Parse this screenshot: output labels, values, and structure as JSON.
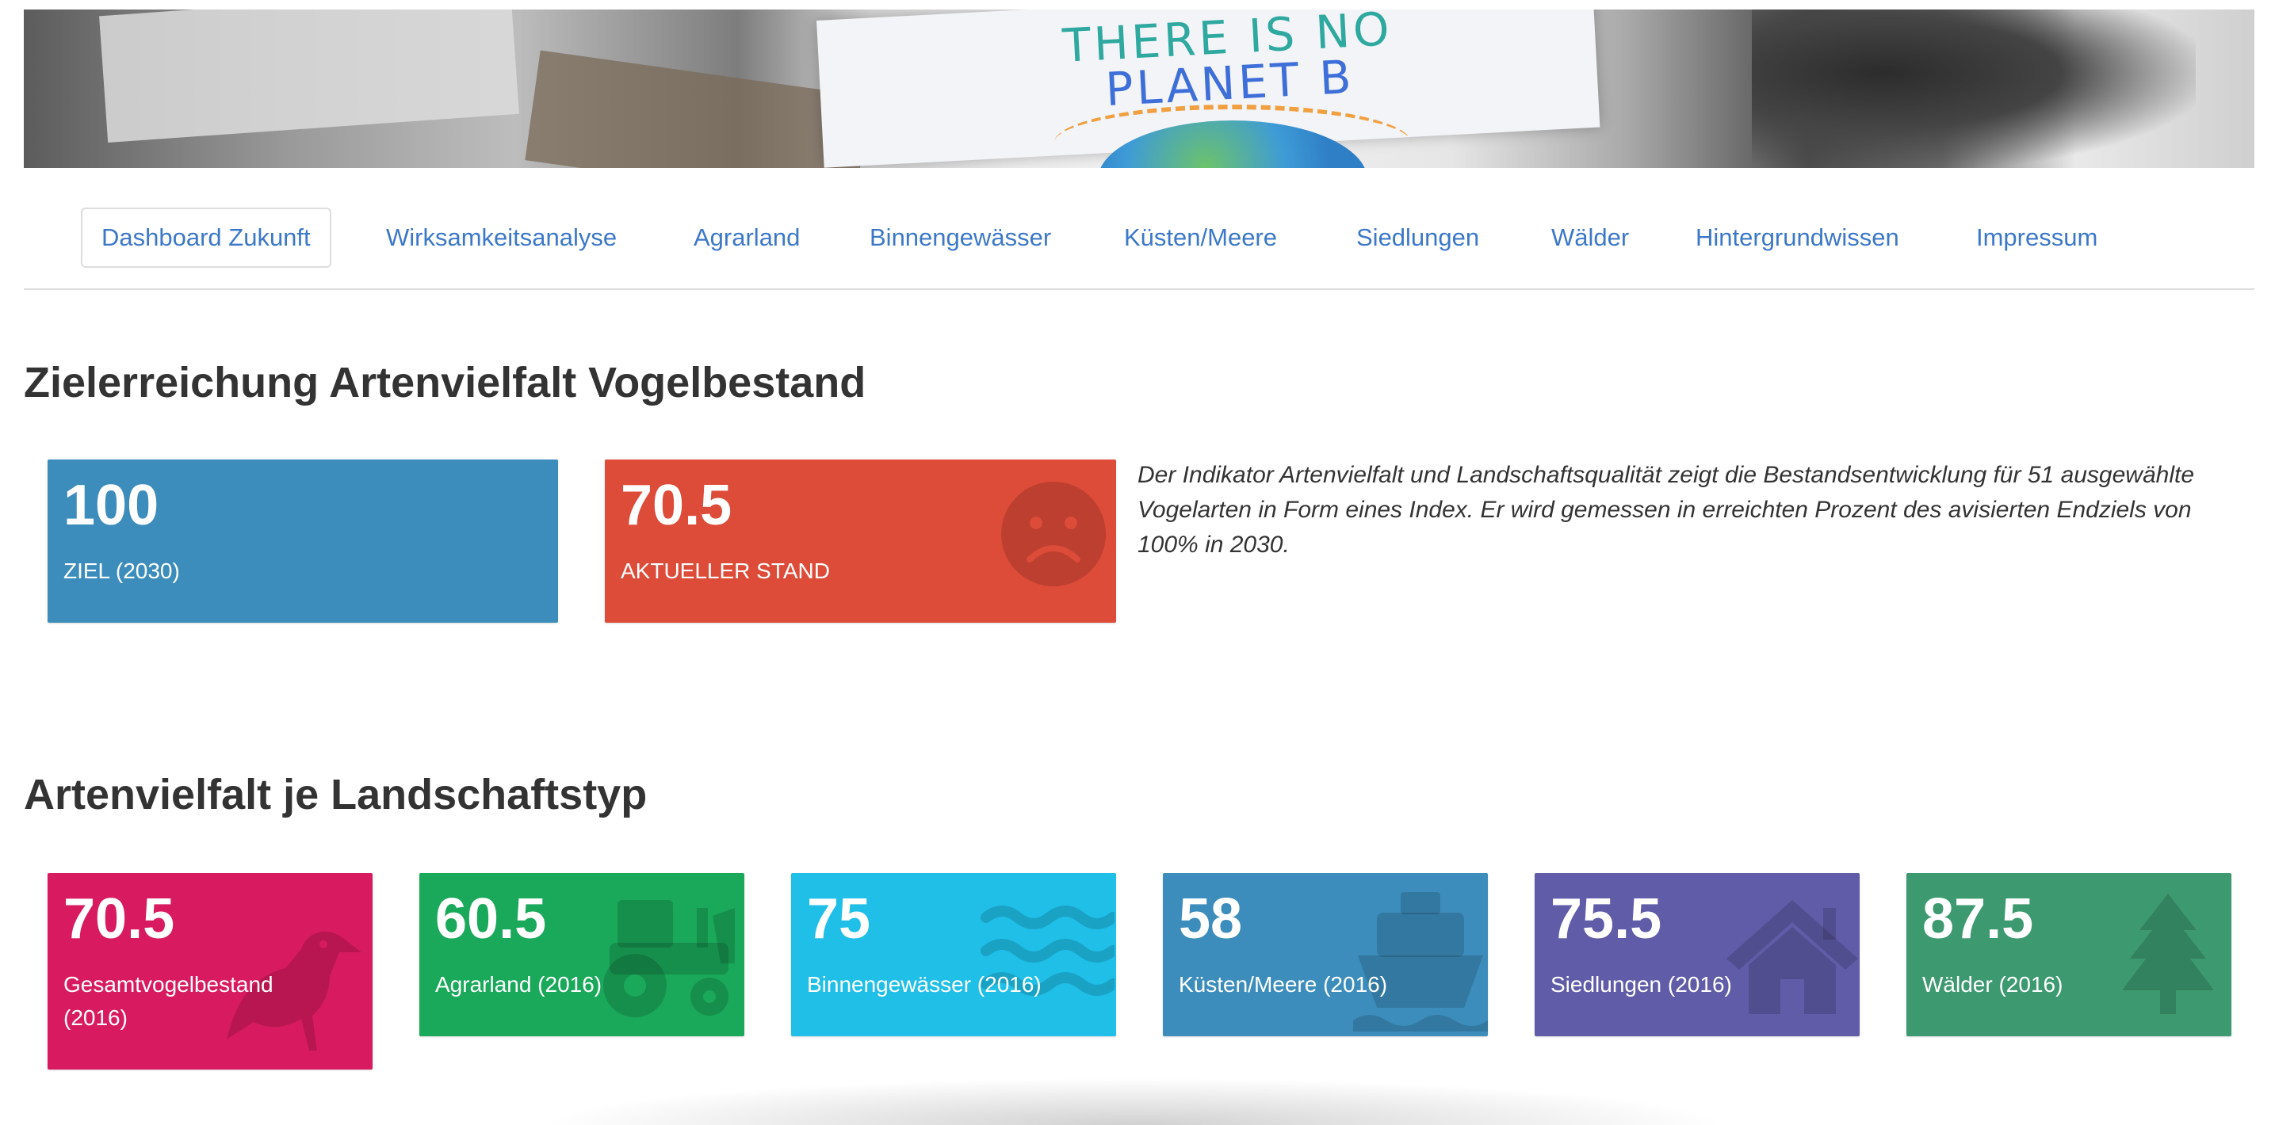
{
  "banner": {
    "sign_line1": "THERE IS NO",
    "sign_line2": "PLANET B"
  },
  "nav": {
    "items": [
      {
        "label": "Dashboard Zukunft"
      },
      {
        "label": "Wirksamkeitsanalyse"
      },
      {
        "label": "Agrarland"
      },
      {
        "label": "Binnengewässer"
      },
      {
        "label": "Küsten/Meere"
      },
      {
        "label": "Siedlungen"
      },
      {
        "label": "Wälder"
      },
      {
        "label": "Hintergrundwissen"
      },
      {
        "label": "Impressum"
      }
    ],
    "active_index": 0
  },
  "goal_section": {
    "title": "Zielerreichung Artenvielfalt Vogelbestand",
    "boxes": [
      {
        "value": "100",
        "caption": "ZIEL (2030)",
        "color": "#3c8dbc",
        "icon": ""
      },
      {
        "value": "70.5",
        "caption": "AKTUELLER STAND",
        "color": "#dd4b39",
        "icon": "frown-icon"
      }
    ],
    "description": "Der Indikator Artenvielfalt und Landschaftsqualität zeigt die Bestandsentwicklung für 51 ausgewählte Vogelarten in Form eines Index. Er wird gemessen in erreichten Prozent des avisierten Endziels von 100% in 2030."
  },
  "landscape_section": {
    "title": "Artenvielfalt je Landschaftstyp",
    "boxes": [
      {
        "value": "70.5",
        "caption": "Gesamtvogelbestand (2016)",
        "color": "#d81b60",
        "icon": "crow-icon"
      },
      {
        "value": "60.5",
        "caption": "Agrarland (2016)",
        "color": "#1aa85a",
        "icon": "tractor-icon"
      },
      {
        "value": "75",
        "caption": "Binnengewässer (2016)",
        "color": "#1fbfe8",
        "icon": "water-icon"
      },
      {
        "value": "58",
        "caption": "Küsten/Meere (2016)",
        "color": "#3c8dbc",
        "icon": "ship-icon"
      },
      {
        "value": "75.5",
        "caption": "Siedlungen (2016)",
        "color": "#605ca8",
        "icon": "home-icon"
      },
      {
        "value": "87.5",
        "caption": "Wälder (2016)",
        "color": "#3d9970",
        "icon": "tree-icon"
      }
    ]
  }
}
